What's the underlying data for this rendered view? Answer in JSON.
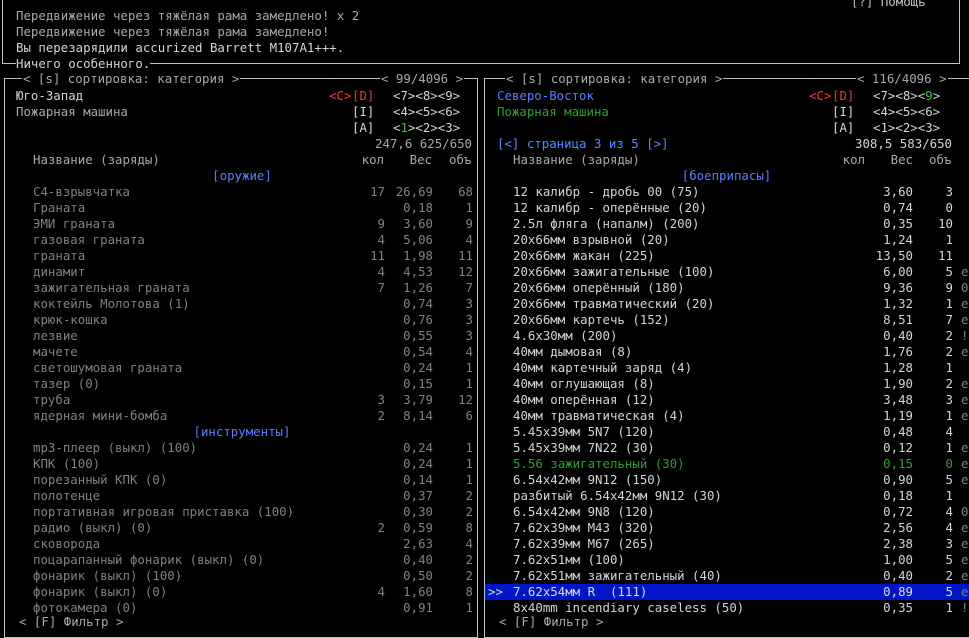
{
  "messages": [
    "Передвижение через тяжёлая рама замедлено! x 2",
    "Передвижение через тяжёлая рама замедлено!",
    "Вы перезарядили accurized Barrett M107A1+++.",
    "Ничего особенного."
  ],
  "help_label": "[?] Помощь",
  "left": {
    "sort_label": "[s] сортировка: категория",
    "count": "99/4096",
    "direction": "Юго-Запад",
    "location": "Пожарная машина",
    "keys": {
      "cd_c": "<C>",
      "cd_d": "[D]",
      "row1": "<7><8><9>",
      "i_label": "[I]",
      "row2": "<4><5><6>",
      "a_label": "[A]",
      "row3_a": "<",
      "row3_b": "1",
      "row3_c": "><2><3>"
    },
    "weight_volume": "247,6 625/650",
    "headers": {
      "name": "Название (заряды)",
      "amount": "кол",
      "weight": "Вес",
      "volume": "объ"
    },
    "rows": [
      {
        "type": "cat",
        "name": "[оружие]"
      },
      {
        "name": "C4-взрывчатка",
        "amt": "17",
        "wt": "26,69",
        "vol": "68"
      },
      {
        "name": "Граната",
        "amt": "",
        "wt": "0,18",
        "vol": "1"
      },
      {
        "name": "ЭМИ граната",
        "amt": "9",
        "wt": "3,60",
        "vol": "9"
      },
      {
        "name": "газовая граната",
        "amt": "4",
        "wt": "5,06",
        "vol": "4"
      },
      {
        "name": "граната",
        "amt": "11",
        "wt": "1,98",
        "vol": "11"
      },
      {
        "name": "динамит",
        "amt": "4",
        "wt": "4,53",
        "vol": "12"
      },
      {
        "name": "зажигательная граната",
        "amt": "7",
        "wt": "1,26",
        "vol": "7"
      },
      {
        "name": "коктейль Молотова (1)",
        "amt": "",
        "wt": "0,74",
        "vol": "3"
      },
      {
        "name": "крюк-кошка",
        "amt": "",
        "wt": "0,76",
        "vol": "3"
      },
      {
        "name": "лезвие",
        "amt": "",
        "wt": "0,55",
        "vol": "3"
      },
      {
        "name": "мачете",
        "amt": "",
        "wt": "0,54",
        "vol": "4"
      },
      {
        "name": "светошумовая граната",
        "amt": "",
        "wt": "0,24",
        "vol": "1"
      },
      {
        "name": "тазер (0)",
        "amt": "",
        "wt": "0,15",
        "vol": "1"
      },
      {
        "name": "труба",
        "amt": "3",
        "wt": "3,79",
        "vol": "12"
      },
      {
        "name": "ядерная мини-бомба",
        "amt": "2",
        "wt": "8,14",
        "vol": "6"
      },
      {
        "type": "cat",
        "name": "[инструменты]"
      },
      {
        "name": "mp3-плеер (выкл) (100)",
        "amt": "",
        "wt": "0,24",
        "vol": "1"
      },
      {
        "name": "КПК (100)",
        "amt": "",
        "wt": "0,24",
        "vol": "1"
      },
      {
        "name": "порезанный КПК (0)",
        "amt": "",
        "wt": "0,14",
        "vol": "1"
      },
      {
        "name": "полотенце",
        "amt": "",
        "wt": "0,37",
        "vol": "2"
      },
      {
        "name": "портативная игровая приставка (100)",
        "amt": "",
        "wt": "0,30",
        "vol": "2"
      },
      {
        "name": "радио (выкл) (0)",
        "amt": "2",
        "wt": "0,59",
        "vol": "8"
      },
      {
        "name": "сковорода",
        "amt": "",
        "wt": "2,63",
        "vol": "4"
      },
      {
        "name": "поцарапанный фонарик (выкл) (0)",
        "amt": "",
        "wt": "0,40",
        "vol": "2"
      },
      {
        "name": "фонарик (выкл) (100)",
        "amt": "",
        "wt": "0,50",
        "vol": "2"
      },
      {
        "name": "фонарик (выкл) (0)",
        "amt": "4",
        "wt": "1,60",
        "vol": "8"
      },
      {
        "name": "фотокамера (0)",
        "amt": "",
        "wt": "0,91",
        "vol": "1"
      }
    ],
    "filter_label": "[F] Фильтр"
  },
  "right": {
    "sort_label": "[s] сортировка: категория",
    "count": "116/4096",
    "direction": "Северо-Восток",
    "location": "Пожарная машина",
    "keys": {
      "cd_c": "<C>",
      "cd_d": "[D]",
      "row1_a": "<7><8><",
      "row1_b": "9",
      "row1_c": ">",
      "i_label": "[I]",
      "row2": "<4><5><6>",
      "a_label": "[A]",
      "row3": "<1><2><3>"
    },
    "page_info": "[<] страница 3 из 5 [>]",
    "weight_volume": "308,5 583/650",
    "headers": {
      "name": "Название (заряды)",
      "amount": "кол",
      "weight": "Вес",
      "volume": "объ"
    },
    "rows": [
      {
        "type": "cat",
        "name": "[боеприпасы]"
      },
      {
        "name": "12 калибр - дробь 00 (75)",
        "wt": "3,60",
        "vol": "3",
        "suf": ""
      },
      {
        "name": "12 калибр - оперённые (20)",
        "wt": "0,74",
        "vol": "0",
        "suf": ""
      },
      {
        "name": "2.5л фляга (напалм) (200)",
        "wt": "0,35",
        "vol": "10",
        "suf": ""
      },
      {
        "name": "20x66мм взрывной (20)",
        "wt": "1,24",
        "vol": "1",
        "suf": ""
      },
      {
        "name": "20x66мм жакан (225)",
        "wt": "13,50",
        "vol": "11",
        "suf": ""
      },
      {
        "name": "20x66мм зажигательные (100)",
        "wt": "6,00",
        "vol": "5",
        "suf": "e"
      },
      {
        "name": "20x66мм оперённый (180)",
        "wt": "9,36",
        "vol": "9",
        "suf": "0"
      },
      {
        "name": "20x66мм травматический (20)",
        "wt": "1,32",
        "vol": "1",
        "suf": "e"
      },
      {
        "name": "20x66мм картечь (152)",
        "wt": "8,51",
        "vol": "7",
        "suf": "e"
      },
      {
        "name": "4.6x30мм (200)",
        "wt": "0,40",
        "vol": "2",
        "suf": "!"
      },
      {
        "name": "40мм дымовая (8)",
        "wt": "1,76",
        "vol": "2",
        "suf": "e"
      },
      {
        "name": "40мм картечный заряд (4)",
        "wt": "1,28",
        "vol": "1",
        "suf": ""
      },
      {
        "name": "40мм оглушающая (8)",
        "wt": "1,90",
        "vol": "2",
        "suf": "e"
      },
      {
        "name": "40мм оперённая (12)",
        "wt": "3,48",
        "vol": "3",
        "suf": "e"
      },
      {
        "name": "40мм травматическая (4)",
        "wt": "1,19",
        "vol": "1",
        "suf": "e"
      },
      {
        "name": "5.45x39мм 5N7 (120)",
        "wt": "0,48",
        "vol": "4",
        "suf": ""
      },
      {
        "name": "5.45x39мм 7N22 (30)",
        "wt": "0,12",
        "vol": "1",
        "suf": "e"
      },
      {
        "name": "5.56 зажигательный (30)",
        "wt": "0,15",
        "vol": "0",
        "suf": "e",
        "style": "grn"
      },
      {
        "name": "6.54x42мм 9N12 (150)",
        "wt": "0,90",
        "vol": "5",
        "suf": "e"
      },
      {
        "name": "разбитый 6.54x42мм 9N12 (30)",
        "wt": "0,18",
        "vol": "1",
        "suf": ""
      },
      {
        "name": "6.54x42мм 9N8 (120)",
        "wt": "0,72",
        "vol": "4",
        "suf": "0"
      },
      {
        "name": "7.62x39мм M43 (320)",
        "wt": "2,56",
        "vol": "4",
        "suf": "e"
      },
      {
        "name": "7.62x39мм M67 (265)",
        "wt": "2,38",
        "vol": "3",
        "suf": "e"
      },
      {
        "name": "7.62x51мм (100)",
        "wt": "1,00",
        "vol": "5",
        "suf": "e"
      },
      {
        "name": "7.62x51мм зажигательный (40)",
        "wt": "0,40",
        "vol": "2",
        "suf": "e"
      },
      {
        "name": "7.62x54мм R  (111)",
        "wt": "0,89",
        "vol": "5",
        "suf": "e",
        "selected": true
      },
      {
        "name": "8x40mm incendiary caseless (50)",
        "wt": "0,35",
        "vol": "1",
        "suf": "!"
      }
    ],
    "selector": ">>",
    "filter_label": "[F] Фильтр"
  }
}
